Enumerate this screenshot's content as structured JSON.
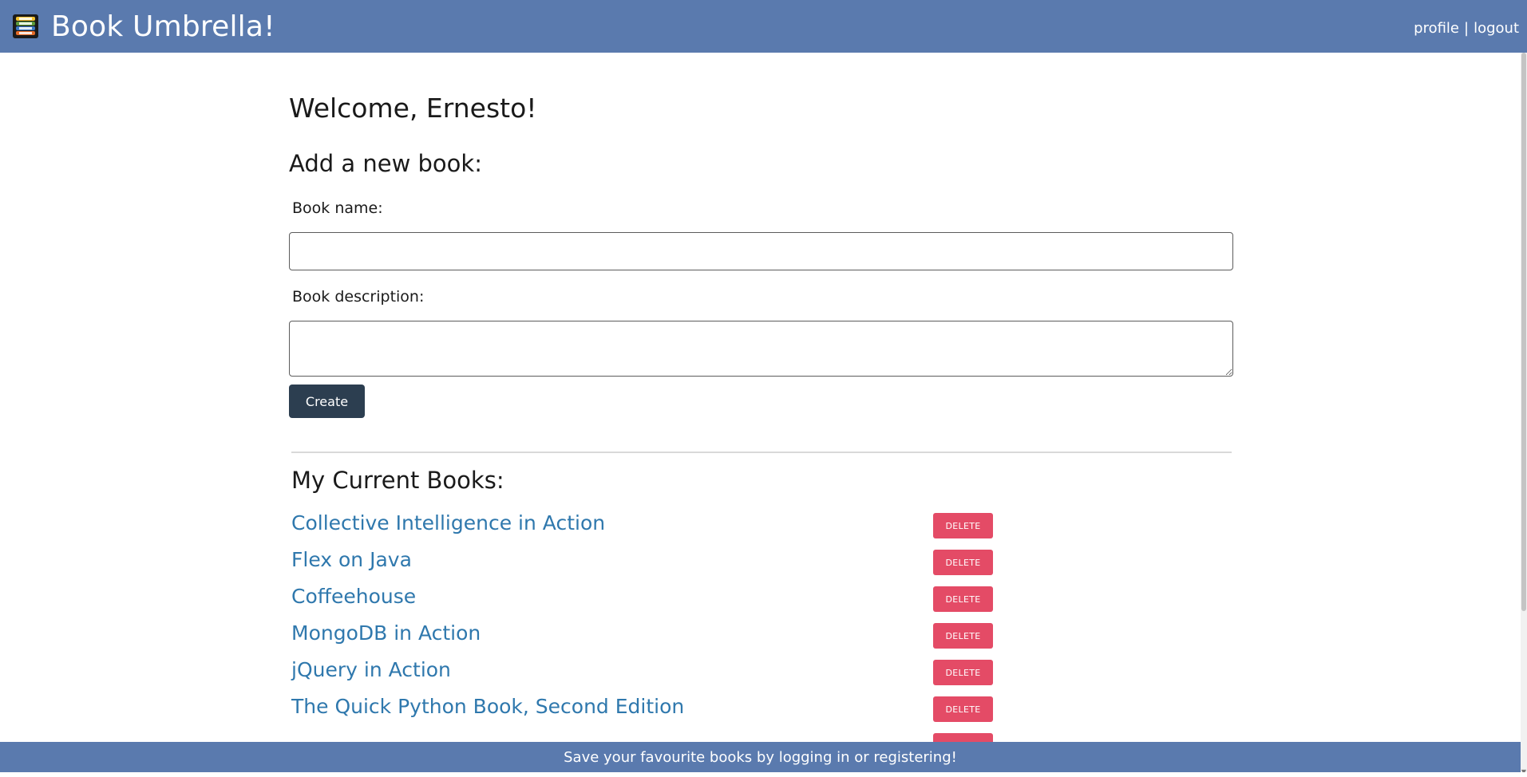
{
  "header": {
    "title": "Book Umbrella!",
    "logo_icon": "books-stack-icon",
    "links": {
      "profile": "profile",
      "separator": "|",
      "logout": "logout"
    }
  },
  "main": {
    "welcome": "Welcome, Ernesto!",
    "add_heading": "Add a new book:",
    "form": {
      "name_label": "Book name:",
      "name_value": "",
      "description_label": "Book description:",
      "description_value": "",
      "create_label": "Create"
    },
    "current_heading": "My Current Books:",
    "delete_label": "DELETE",
    "books": [
      {
        "title": "Collective Intelligence in Action"
      },
      {
        "title": "Flex on Java"
      },
      {
        "title": "Coffeehouse"
      },
      {
        "title": "MongoDB in Action"
      },
      {
        "title": "jQuery in Action"
      },
      {
        "title": "The Quick Python Book, Second Edition"
      },
      {
        "title": ""
      }
    ]
  },
  "footer": {
    "text": "Save your favourite books by logging in or registering!"
  },
  "colors": {
    "header_bg": "#5a7aae",
    "link": "#2f78ad",
    "delete": "#e44b66",
    "create": "#2c3e50"
  }
}
